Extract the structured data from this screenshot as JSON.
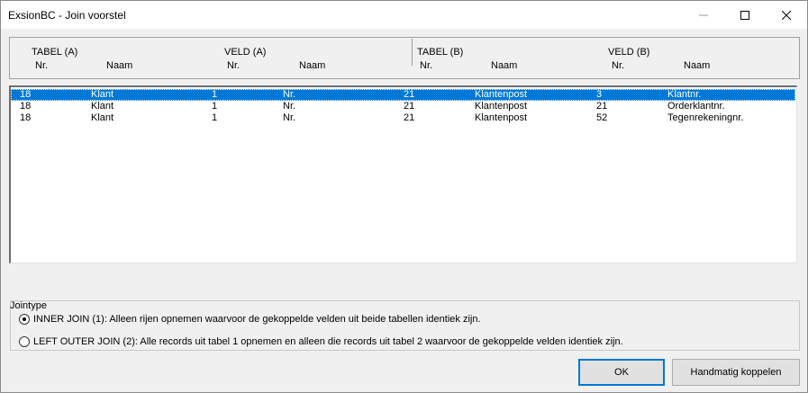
{
  "window": {
    "title": "ExsionBC - Join voorstel",
    "controls": [
      "minimize-icon",
      "maximize-icon",
      "close-icon"
    ]
  },
  "header": {
    "tabel_a": "TABEL (A)",
    "veld_a": "VELD (A)",
    "tabel_b": "TABEL (B)",
    "veld_b": "VELD (B)",
    "nr": "Nr.",
    "naam": "Naam"
  },
  "rows": [
    {
      "a_nr": "18",
      "a_naam": "Klant",
      "va_nr": "1",
      "va_naam": "Nr.",
      "b_nr": "21",
      "b_naam": "Klantenpost",
      "vb_nr": "3",
      "vb_naam": "Klantnr.",
      "selected": true
    },
    {
      "a_nr": "18",
      "a_naam": "Klant",
      "va_nr": "1",
      "va_naam": "Nr.",
      "b_nr": "21",
      "b_naam": "Klantenpost",
      "vb_nr": "21",
      "vb_naam": "Orderklantnr.",
      "selected": false
    },
    {
      "a_nr": "18",
      "a_naam": "Klant",
      "va_nr": "1",
      "va_naam": "Nr.",
      "b_nr": "21",
      "b_naam": "Klantenpost",
      "vb_nr": "52",
      "vb_naam": "Tegenrekeningnr.",
      "selected": false
    }
  ],
  "jointype": {
    "legend": "Jointype",
    "options": [
      {
        "label": "INNER JOIN (1): Alleen rijen opnemen waarvoor de gekoppelde velden uit beide tabellen identiek zijn.",
        "checked": true
      },
      {
        "label": "LEFT OUTER JOIN (2): Alle records uit tabel 1 opnemen en alleen die records uit tabel 2 waarvoor de gekoppelde velden identiek zijn.",
        "checked": false
      }
    ]
  },
  "buttons": {
    "ok": "OK",
    "manual": "Handmatig koppelen"
  },
  "colors": {
    "selection": "#0078d7",
    "window_bg": "#f0f0f0"
  }
}
